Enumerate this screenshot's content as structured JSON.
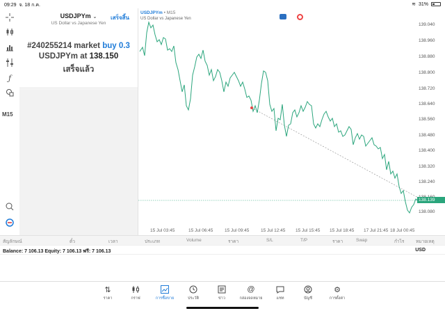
{
  "status_bar": {
    "time": "09:29",
    "date": "จ. 18 ก.ค.",
    "battery": "31%"
  },
  "left_toolbar": {
    "items": [
      "crosshair-icon",
      "candles-icon",
      "bars-icon",
      "indicator-icon",
      "function-icon",
      "objects-icon"
    ],
    "timeframe": "M15"
  },
  "order": {
    "symbol": "USDJPYm",
    "description": "US Dollar vs Japanese Yen",
    "done_label": "เสร็จสิ้น",
    "ticket_text": "#240255214 market",
    "action_text": "buy 0.3",
    "line2_prefix": "USDJPYm at",
    "price": "138.150",
    "status": "เสร็จแล้ว"
  },
  "chart": {
    "symbol": "USDJPYm",
    "timeframe": "M15",
    "description": "US Dollar vs Japanese Yen",
    "price_labels": [
      "139.040",
      "138.960",
      "138.880",
      "138.800",
      "138.720",
      "138.640",
      "138.560",
      "138.480",
      "138.400",
      "138.320",
      "138.240",
      "138.160",
      "138.080"
    ],
    "current_price": "138.139",
    "time_labels": [
      "15 Jul 03:45",
      "15 Jul 06:45",
      "15 Jul 09:45",
      "15 Jul 12:45",
      "15 Jul 15:45",
      "15 Jul 18:45",
      "17 Jul 21:45",
      "18 Jul 00:45"
    ],
    "line_color": "#2aa57c",
    "accent_color": "#1e7bd8"
  },
  "table": {
    "headers": [
      "สัญลักษณ์",
      "ตั๋ว",
      "เวลา",
      "ประเภท",
      "Volume",
      "ราคา",
      "S/L",
      "T/P",
      "ราคา",
      "Swap",
      "กำไร",
      "หมายเหตุ"
    ]
  },
  "account": {
    "balance_text": "Balance: 7 106.13 Equity: 7 106.13 ฟรี: 7 106.13",
    "currency": "USD"
  },
  "tabs": [
    {
      "label": "ราคา",
      "icon": "arrows-updown-icon",
      "active": false
    },
    {
      "label": "กราฟ",
      "icon": "candles-icon",
      "active": false
    },
    {
      "label": "การซื้อขาย",
      "icon": "trend-chart-icon",
      "active": true
    },
    {
      "label": "ประวัติ",
      "icon": "history-icon",
      "active": false
    },
    {
      "label": "ข่าว",
      "icon": "news-icon",
      "active": false
    },
    {
      "label": "กล่องจดหมาย",
      "icon": "at-icon",
      "active": false
    },
    {
      "label": "แชท",
      "icon": "chat-icon",
      "active": false
    },
    {
      "label": "บัญชี",
      "icon": "account-icon",
      "active": false
    },
    {
      "label": "การตั้งค่า",
      "icon": "settings-icon",
      "active": false
    }
  ]
}
